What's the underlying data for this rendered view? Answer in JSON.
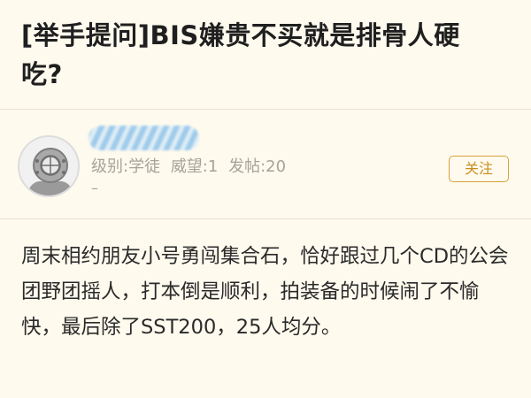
{
  "post": {
    "title": "[举手提问]BIS嫌贵不买就是排骨人硬吃?",
    "content": "周末相约朋友小号勇闯集合石，恰好跟过几个CD的公会团野团摇人，打本倒是顺利，拍装备的时候闹了不愉快，最后除了SST200，25人均分。"
  },
  "author": {
    "avatar_icon": "diving-helmet-avatar-icon",
    "level": "级别:学徒",
    "prestige": "威望:1",
    "posts": "发帖:20",
    "extra": "–",
    "follow_label": "关注"
  },
  "colors": {
    "background": "#fffaee",
    "follow_accent": "#d9a23a",
    "meta_text": "#a7a39a",
    "username_blur": "#8fc3ea"
  }
}
